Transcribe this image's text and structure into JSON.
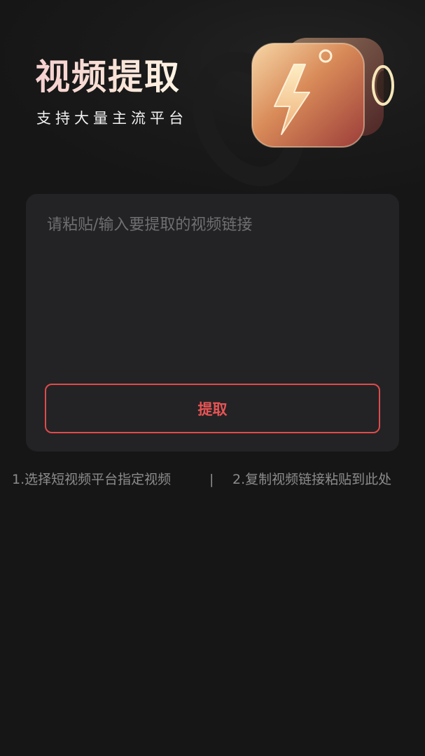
{
  "header": {
    "title": "视频提取",
    "subtitle": "支持大量主流平台",
    "illustration_icon": "lightning-camera-icon"
  },
  "input": {
    "placeholder": "请粘贴/输入要提取的视频链接",
    "value": ""
  },
  "actions": {
    "extract_label": "提取"
  },
  "instructions": {
    "step1": "1.选择短视频平台指定视频",
    "separator": "|",
    "step2": "2.复制视频链接粘贴到此处"
  },
  "colors": {
    "background": "#161616",
    "card": "#232325",
    "accent": "#e04b4b",
    "placeholder": "#6f6f72",
    "hint_text": "#8c8c8c"
  }
}
